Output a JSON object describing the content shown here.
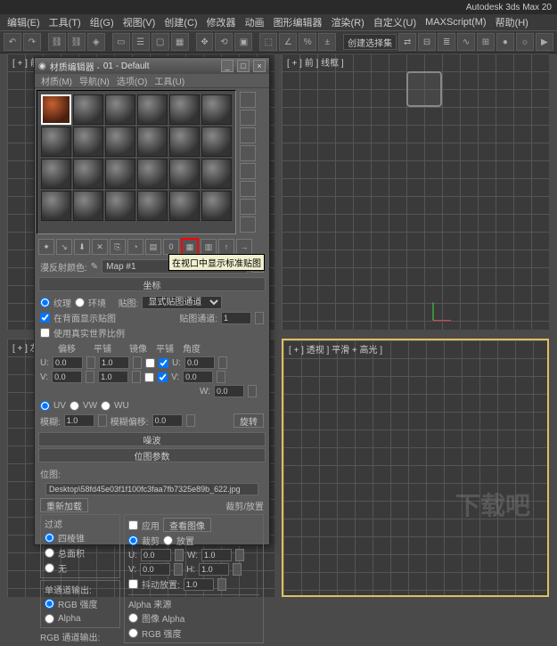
{
  "app": {
    "title": "Autodesk 3ds Max  20"
  },
  "menu": [
    "编辑(E)",
    "工具(T)",
    "组(G)",
    "视图(V)",
    "创建(C)",
    "修改器",
    "动画",
    "图形编辑器",
    "渲染(R)",
    "自定义(U)",
    "MAXScript(M)",
    "帮助(H)"
  ],
  "tool_combo": "创建选择集",
  "viewports": {
    "tl_label": "[ + ] 前 ] 线框 ]",
    "tr_label": "[ + ] 前 ] 线框 ]",
    "bl_label": "[ + ] 左",
    "br_label": "[ + ] 透视 ] 平滑 + 高光 ]"
  },
  "mateditor": {
    "title_prefix": "材质编辑器 - ",
    "mat_name": "01 - Default",
    "menu": [
      "材质(M)",
      "导航(N)",
      "选项(O)",
      "工具(U)"
    ],
    "tooltip": "在视口中显示标准贴图",
    "diffuse_label": "漫反射颜色:",
    "map_name": "Map #1",
    "rollouts": {
      "coords": "坐标",
      "noise": "噪波",
      "bitmap_params": "位图参数"
    },
    "coords": {
      "radio_texture": "纹理",
      "radio_environ": "环境",
      "map_label": "贴图:",
      "map_combo": "显式贴图通道",
      "show_back": "在背面显示贴图",
      "channel_label": "贴图通道:",
      "channel_val": "1",
      "real_world": "使用真实世界比例",
      "hdr": {
        "offset": "偏移",
        "tiling": "平铺",
        "mirror": "镜像",
        "tile": "平铺",
        "angle": "角度"
      },
      "u_label": "U:",
      "v_label": "V:",
      "w_label": "W:",
      "u_off": "0.0",
      "u_tile": "1.0",
      "u_ang": "0.0",
      "v_off": "0.0",
      "v_tile": "1.0",
      "v_ang": "0.0",
      "w_ang": "0.0",
      "uv": "UV",
      "vw": "VW",
      "wu": "WU",
      "blur_label": "模糊:",
      "blur_val": "1.0",
      "bluroff_label": "模糊偏移:",
      "bluroff_val": "0.0",
      "rotate": "旋转"
    },
    "bitmap": {
      "path_label": "位图:",
      "path": "Desktop\\58fd45e03f1f100fc3faa7fb7325e89b_622.jpg",
      "reload": "重新加载",
      "crop_header": "裁剪/放置",
      "apply": "应用",
      "view": "查看图像",
      "crop": "裁剪",
      "place": "放置",
      "u": "U:",
      "v": "V:",
      "w": "W:",
      "h": "H:",
      "u_val": "0.0",
      "v_val": "0.0",
      "w_val": "1.0",
      "h_val": "1.0",
      "jitter": "抖动放置:",
      "jitter_val": "1.0",
      "filter_hdr": "过滤",
      "f_pyramid": "四棱锥",
      "f_sum": "总面积",
      "f_none": "无",
      "mono_hdr": "单通道输出:",
      "mono_rgb": "RGB 强度",
      "mono_alpha": "Alpha",
      "rgb_hdr": "RGB 通道输出:",
      "alpha_src": "Alpha 来源",
      "alpha_img": "图像 Alpha",
      "alpha_rgb": "RGB 强度"
    }
  },
  "watermark": "下载吧"
}
